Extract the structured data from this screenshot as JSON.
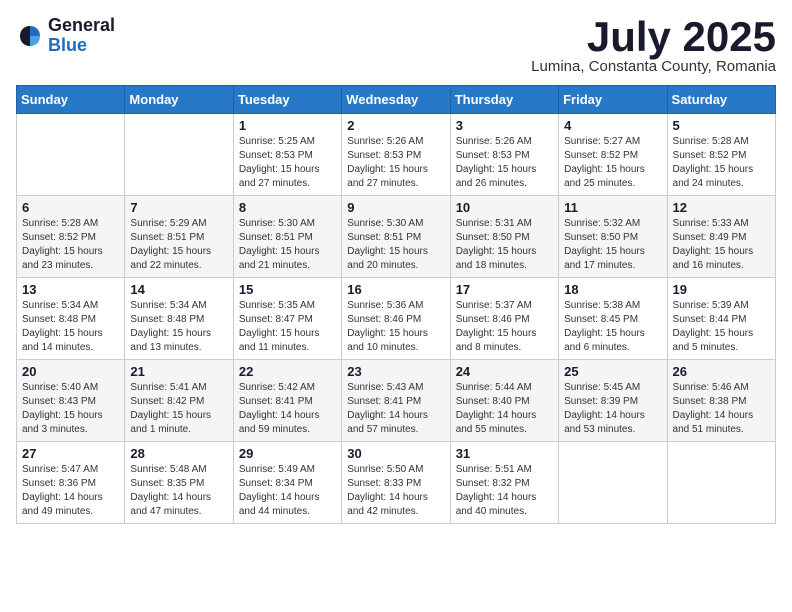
{
  "logo": {
    "general": "General",
    "blue": "Blue"
  },
  "header": {
    "month": "July 2025",
    "location": "Lumina, Constanta County, Romania"
  },
  "days_of_week": [
    "Sunday",
    "Monday",
    "Tuesday",
    "Wednesday",
    "Thursday",
    "Friday",
    "Saturday"
  ],
  "weeks": [
    [
      {
        "day": "",
        "detail": ""
      },
      {
        "day": "",
        "detail": ""
      },
      {
        "day": "1",
        "detail": "Sunrise: 5:25 AM\nSunset: 8:53 PM\nDaylight: 15 hours\nand 27 minutes."
      },
      {
        "day": "2",
        "detail": "Sunrise: 5:26 AM\nSunset: 8:53 PM\nDaylight: 15 hours\nand 27 minutes."
      },
      {
        "day": "3",
        "detail": "Sunrise: 5:26 AM\nSunset: 8:53 PM\nDaylight: 15 hours\nand 26 minutes."
      },
      {
        "day": "4",
        "detail": "Sunrise: 5:27 AM\nSunset: 8:52 PM\nDaylight: 15 hours\nand 25 minutes."
      },
      {
        "day": "5",
        "detail": "Sunrise: 5:28 AM\nSunset: 8:52 PM\nDaylight: 15 hours\nand 24 minutes."
      }
    ],
    [
      {
        "day": "6",
        "detail": "Sunrise: 5:28 AM\nSunset: 8:52 PM\nDaylight: 15 hours\nand 23 minutes."
      },
      {
        "day": "7",
        "detail": "Sunrise: 5:29 AM\nSunset: 8:51 PM\nDaylight: 15 hours\nand 22 minutes."
      },
      {
        "day": "8",
        "detail": "Sunrise: 5:30 AM\nSunset: 8:51 PM\nDaylight: 15 hours\nand 21 minutes."
      },
      {
        "day": "9",
        "detail": "Sunrise: 5:30 AM\nSunset: 8:51 PM\nDaylight: 15 hours\nand 20 minutes."
      },
      {
        "day": "10",
        "detail": "Sunrise: 5:31 AM\nSunset: 8:50 PM\nDaylight: 15 hours\nand 18 minutes."
      },
      {
        "day": "11",
        "detail": "Sunrise: 5:32 AM\nSunset: 8:50 PM\nDaylight: 15 hours\nand 17 minutes."
      },
      {
        "day": "12",
        "detail": "Sunrise: 5:33 AM\nSunset: 8:49 PM\nDaylight: 15 hours\nand 16 minutes."
      }
    ],
    [
      {
        "day": "13",
        "detail": "Sunrise: 5:34 AM\nSunset: 8:48 PM\nDaylight: 15 hours\nand 14 minutes."
      },
      {
        "day": "14",
        "detail": "Sunrise: 5:34 AM\nSunset: 8:48 PM\nDaylight: 15 hours\nand 13 minutes."
      },
      {
        "day": "15",
        "detail": "Sunrise: 5:35 AM\nSunset: 8:47 PM\nDaylight: 15 hours\nand 11 minutes."
      },
      {
        "day": "16",
        "detail": "Sunrise: 5:36 AM\nSunset: 8:46 PM\nDaylight: 15 hours\nand 10 minutes."
      },
      {
        "day": "17",
        "detail": "Sunrise: 5:37 AM\nSunset: 8:46 PM\nDaylight: 15 hours\nand 8 minutes."
      },
      {
        "day": "18",
        "detail": "Sunrise: 5:38 AM\nSunset: 8:45 PM\nDaylight: 15 hours\nand 6 minutes."
      },
      {
        "day": "19",
        "detail": "Sunrise: 5:39 AM\nSunset: 8:44 PM\nDaylight: 15 hours\nand 5 minutes."
      }
    ],
    [
      {
        "day": "20",
        "detail": "Sunrise: 5:40 AM\nSunset: 8:43 PM\nDaylight: 15 hours\nand 3 minutes."
      },
      {
        "day": "21",
        "detail": "Sunrise: 5:41 AM\nSunset: 8:42 PM\nDaylight: 15 hours\nand 1 minute."
      },
      {
        "day": "22",
        "detail": "Sunrise: 5:42 AM\nSunset: 8:41 PM\nDaylight: 14 hours\nand 59 minutes."
      },
      {
        "day": "23",
        "detail": "Sunrise: 5:43 AM\nSunset: 8:41 PM\nDaylight: 14 hours\nand 57 minutes."
      },
      {
        "day": "24",
        "detail": "Sunrise: 5:44 AM\nSunset: 8:40 PM\nDaylight: 14 hours\nand 55 minutes."
      },
      {
        "day": "25",
        "detail": "Sunrise: 5:45 AM\nSunset: 8:39 PM\nDaylight: 14 hours\nand 53 minutes."
      },
      {
        "day": "26",
        "detail": "Sunrise: 5:46 AM\nSunset: 8:38 PM\nDaylight: 14 hours\nand 51 minutes."
      }
    ],
    [
      {
        "day": "27",
        "detail": "Sunrise: 5:47 AM\nSunset: 8:36 PM\nDaylight: 14 hours\nand 49 minutes."
      },
      {
        "day": "28",
        "detail": "Sunrise: 5:48 AM\nSunset: 8:35 PM\nDaylight: 14 hours\nand 47 minutes."
      },
      {
        "day": "29",
        "detail": "Sunrise: 5:49 AM\nSunset: 8:34 PM\nDaylight: 14 hours\nand 44 minutes."
      },
      {
        "day": "30",
        "detail": "Sunrise: 5:50 AM\nSunset: 8:33 PM\nDaylight: 14 hours\nand 42 minutes."
      },
      {
        "day": "31",
        "detail": "Sunrise: 5:51 AM\nSunset: 8:32 PM\nDaylight: 14 hours\nand 40 minutes."
      },
      {
        "day": "",
        "detail": ""
      },
      {
        "day": "",
        "detail": ""
      }
    ]
  ]
}
